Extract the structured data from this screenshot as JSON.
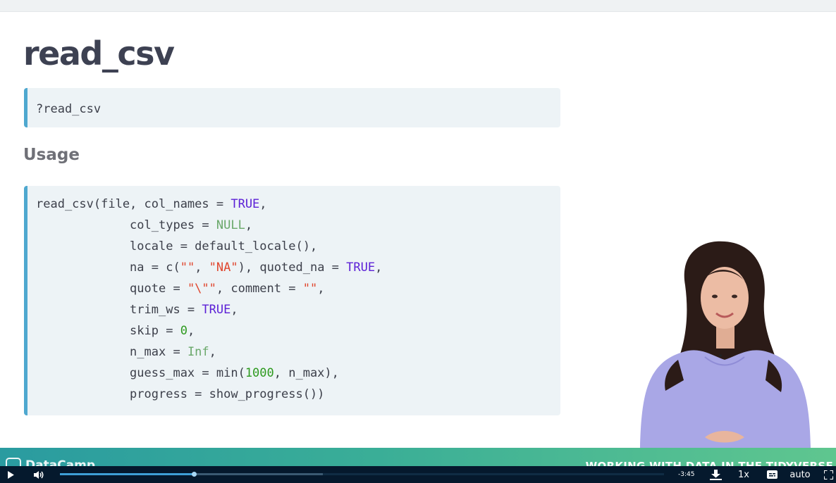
{
  "slide": {
    "title": "read_csv",
    "help_command": "?read_csv",
    "section_heading": "Usage",
    "usage_code": [
      [
        {
          "t": "read_csv(file, col_names = "
        },
        {
          "t": "TRUE",
          "c": "keyword"
        },
        {
          "t": ","
        }
      ],
      [
        {
          "t": "             col_types = "
        },
        {
          "t": "NULL",
          "c": "null"
        },
        {
          "t": ","
        }
      ],
      [
        {
          "t": "             locale = default_locale(),"
        }
      ],
      [
        {
          "t": "             na = c("
        },
        {
          "t": "\"\"",
          "c": "string"
        },
        {
          "t": ", "
        },
        {
          "t": "\"NA\"",
          "c": "string"
        },
        {
          "t": "), quoted_na = "
        },
        {
          "t": "TRUE",
          "c": "keyword"
        },
        {
          "t": ","
        }
      ],
      [
        {
          "t": "             quote = "
        },
        {
          "t": "\"\\\"\"",
          "c": "string"
        },
        {
          "t": ", comment = "
        },
        {
          "t": "\"\"",
          "c": "string"
        },
        {
          "t": ","
        }
      ],
      [
        {
          "t": "             trim_ws = "
        },
        {
          "t": "TRUE",
          "c": "keyword"
        },
        {
          "t": ","
        }
      ],
      [
        {
          "t": "             skip = "
        },
        {
          "t": "0",
          "c": "number"
        },
        {
          "t": ","
        }
      ],
      [
        {
          "t": "             n_max = "
        },
        {
          "t": "Inf",
          "c": "null"
        },
        {
          "t": ","
        }
      ],
      [
        {
          "t": "             guess_max = min("
        },
        {
          "t": "1000",
          "c": "number"
        },
        {
          "t": ", n_max),"
        }
      ],
      [
        {
          "t": "             progress = show_progress())"
        }
      ]
    ]
  },
  "colors": {
    "accent_bar": "#4fa8cf",
    "keyword": "#5b1fd6",
    "null": "#6aa86a",
    "string": "#e0472f",
    "number": "#2e9a1f",
    "player_background": "#05192d"
  },
  "footer": {
    "brand": "DataCamp",
    "course_title": "WORKING WITH DATA IN THE TIDYVERSE"
  },
  "player": {
    "progress_fraction": 0.222,
    "buffered_fraction": 0.435,
    "time_remaining": "-3:45",
    "speed": "1x",
    "quality": "auto",
    "icons": [
      "play-icon",
      "volume-icon",
      "download-icon",
      "captions-icon",
      "fullscreen-icon"
    ]
  }
}
